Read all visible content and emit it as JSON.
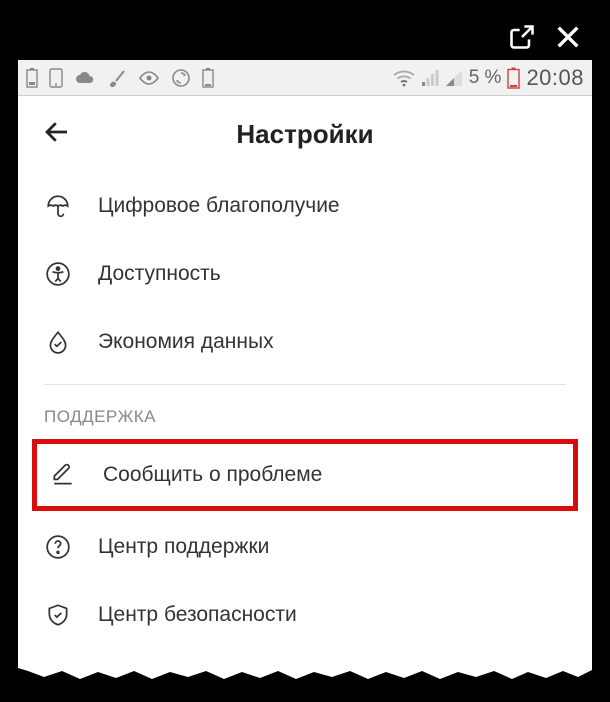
{
  "status_bar": {
    "battery_percent": "5 %",
    "time": "20:08"
  },
  "header": {
    "title": "Настройки"
  },
  "items": {
    "digital_wellbeing": "Цифровое благополучие",
    "accessibility": "Доступность",
    "data_saver": "Экономия данных"
  },
  "section": {
    "support": "ПОДДЕРЖКА"
  },
  "support_items": {
    "report_problem": "Сообщить о проблеме",
    "help_center": "Центр поддержки",
    "safety_center": "Центр безопасности"
  }
}
